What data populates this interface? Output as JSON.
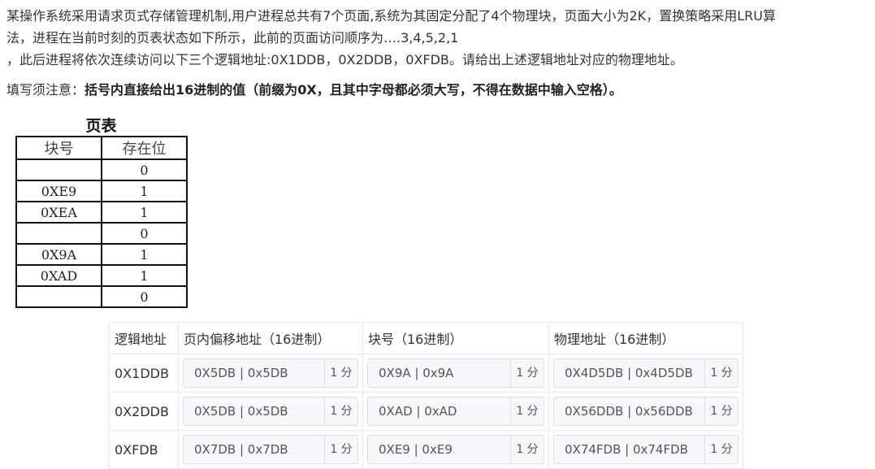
{
  "problem": {
    "line1": "某操作系统采用请求页式存储管理机制,用户进程总共有7个页面,系统为其固定分配了4个物理块，页面大小为2K，置换策略采用LRU算",
    "line2": "法，进程在当前时刻的页表状态如下所示，此前的页面访问顺序为….3,4,5,2,1",
    "line3": "，此后进程将依次连续访问以下三个逻辑地址:0X1DDB，0X2DDB，0XFDB。请给出上述逻辑地址对应的物理地址。"
  },
  "note": {
    "prefix": "填写须注意：",
    "bold": "括号内直接给出16进制的值（前缀为0X，且其中字母都必须大写，不得在数据中输入空格）。"
  },
  "page_table": {
    "title": "页表",
    "headers": [
      "块号",
      "存在位"
    ],
    "rows": [
      {
        "block": "",
        "present": "0"
      },
      {
        "block": "0XE9",
        "present": "1"
      },
      {
        "block": "0XEA",
        "present": "1"
      },
      {
        "block": "",
        "present": "0"
      },
      {
        "block": "0X9A",
        "present": "1"
      },
      {
        "block": "0XAD",
        "present": "1"
      },
      {
        "block": "",
        "present": "0"
      }
    ]
  },
  "answer_table": {
    "headers": [
      "逻辑地址",
      "页内偏移地址（16进制）",
      "块号（16进制）",
      "物理地址（16进制）"
    ],
    "score_label": "1 分",
    "rows": [
      {
        "addr": "0X1DDB",
        "offset": "0X5DB | 0x5DB",
        "block": "0X9A | 0x9A",
        "phys": "0X4D5DB | 0x4D5DB"
      },
      {
        "addr": "0X2DDB",
        "offset": "0X5DB | 0x5DB",
        "block": "0XAD | 0xAD",
        "phys": "0X56DDB | 0x56DDB"
      },
      {
        "addr": "0XFDB",
        "offset": "0X7DB | 0x7DB",
        "block": "0XE9 | 0xE9",
        "phys": "0X74FDB | 0x74FDB"
      }
    ]
  }
}
